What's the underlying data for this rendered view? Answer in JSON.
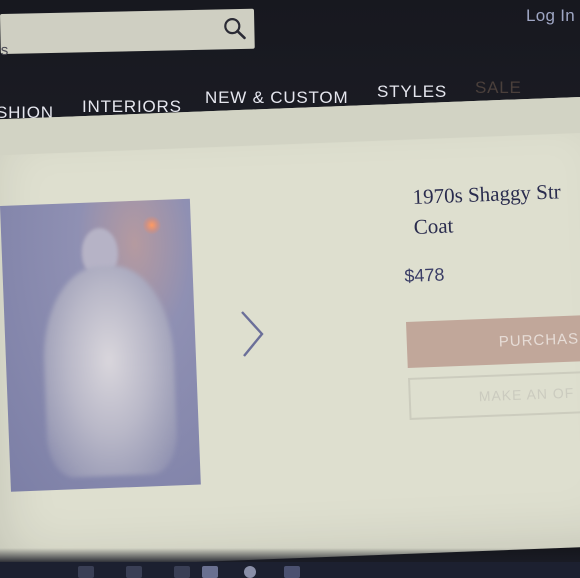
{
  "header": {
    "search": {
      "value": "s",
      "icon": "search-icon"
    },
    "login_label": "Log In"
  },
  "nav": {
    "items": [
      {
        "label": "SHION"
      },
      {
        "label": "INTERIORS"
      },
      {
        "label": "NEW & CUSTOM"
      },
      {
        "label": "STYLES"
      },
      {
        "label": "SALE"
      }
    ]
  },
  "product": {
    "title_line1": "1970s Shaggy Str",
    "title_line2": "Coat",
    "price": "$478",
    "purchase_label": "PURCHAS",
    "offer_label": "MAKE AN OF",
    "next_icon": "chevron-right-icon"
  },
  "colors": {
    "header_bg": "#17181f",
    "page_bg": "#dedfcf",
    "purchase_bg": "#c1a79a",
    "title_color": "#2a2c4e",
    "sale_color": "#4a3f3b"
  }
}
